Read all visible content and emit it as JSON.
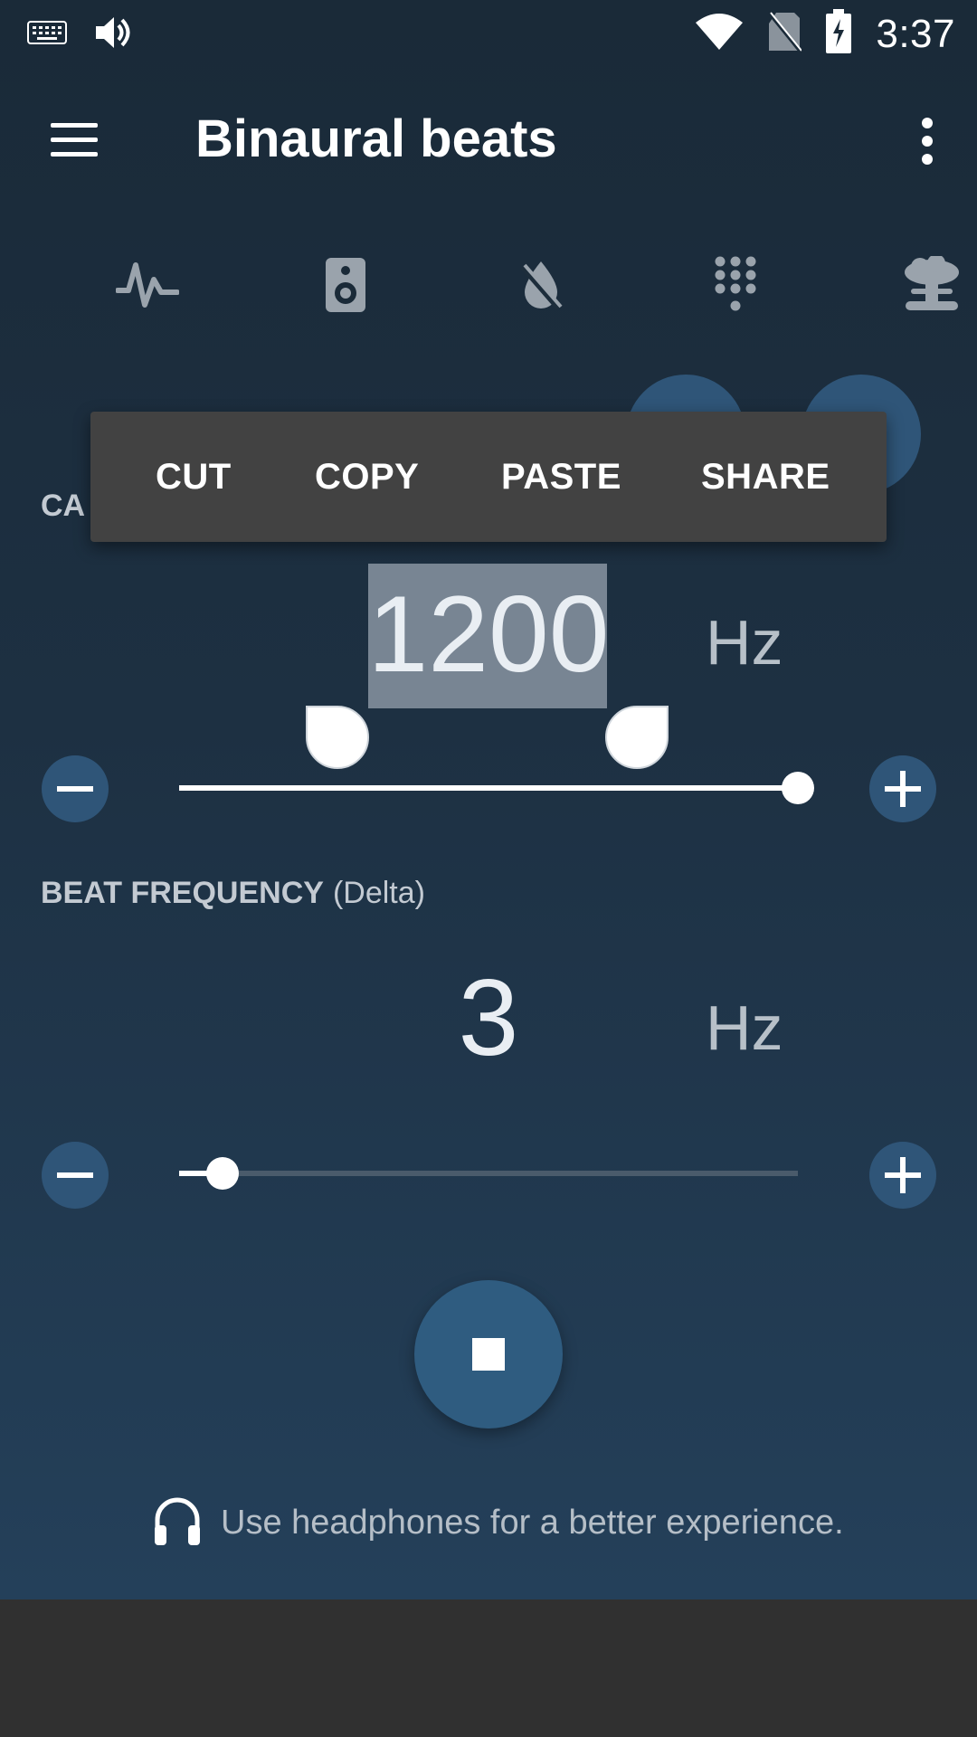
{
  "status_bar": {
    "time": "3:37",
    "icons": [
      "keyboard-icon",
      "volume-icon",
      "wifi-icon",
      "no-sim-icon",
      "battery-charging-icon"
    ]
  },
  "toolbar": {
    "title": "Binaural beats",
    "menu_icon": "hamburger-menu-icon",
    "overflow_icon": "more-vert-icon"
  },
  "categories": [
    "waveform-icon",
    "speaker-icon",
    "no-drop-icon",
    "dialpad-icon",
    "mushroom-cloud-icon"
  ],
  "carrier": {
    "label_partial": "CA",
    "value": "1200",
    "unit": "Hz",
    "slider_fraction": 1.0
  },
  "context_menu": {
    "cut": "CUT",
    "copy": "COPY",
    "paste": "PASTE",
    "share": "SHARE"
  },
  "beat": {
    "label": "BEAT FREQUENCY",
    "sublabel": "(Delta)",
    "value": "3",
    "unit": "Hz",
    "slider_fraction": 0.07
  },
  "play": {
    "icon": "stop-icon"
  },
  "hint": {
    "icon": "headphones-icon",
    "text": "Use headphones for a better experience."
  },
  "colors": {
    "accent": "#2f5578",
    "background_top": "#1a2a38",
    "background_bottom": "#24405a",
    "menu_bg": "#424242",
    "selection": "#788593"
  }
}
